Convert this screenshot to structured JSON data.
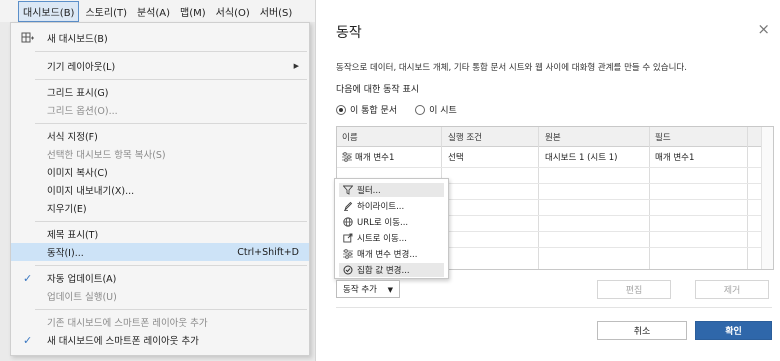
{
  "menubar": {
    "items": [
      "대시보드(B)",
      "스토리(T)",
      "분석(A)",
      "맵(M)",
      "서식(O)",
      "서버(S)"
    ],
    "active": "대시보드(B)"
  },
  "dropdown": {
    "items": [
      {
        "label": "새 대시보드(B)",
        "icon": "new-dashboard-icon"
      },
      {
        "label": "기기 레이아웃(L)",
        "submenu": true
      },
      {
        "label": "그리드 표시(G)"
      },
      {
        "label": "그리드 옵션(O)...",
        "disabled": true
      },
      {
        "label": "서식 지정(F)"
      },
      {
        "label": "선택한 대시보드 항목 복사(S)",
        "disabled": true
      },
      {
        "label": "이미지 복사(C)"
      },
      {
        "label": "이미지 내보내기(X)..."
      },
      {
        "label": "지우기(E)"
      },
      {
        "label": "제목 표시(T)"
      },
      {
        "label": "동작(I)...",
        "shortcut": "Ctrl+Shift+D",
        "highlighted": true
      },
      {
        "label": "자동 업데이트(A)",
        "checked": true
      },
      {
        "label": "업데이트 실행(U)",
        "disabled": true
      },
      {
        "label": "기존 대시보드에 스마트폰 레이아웃 추가",
        "disabled": true
      },
      {
        "label": "새 대시보드에 스마트폰 레이아웃 추가",
        "checked": true
      }
    ]
  },
  "dialog": {
    "title": "동작",
    "close_icon": "×",
    "description": "동작으로 데이터, 대시보드 개체, 기타 통합 문서 시트와 웹 사이에 대화형 관계를 만들 수 있습니다.",
    "for_label": "다음에 대한 동작 표시",
    "radio_options": [
      {
        "label": "이 통합 문서",
        "selected": true
      },
      {
        "label": "이 시트",
        "selected": false
      }
    ],
    "table": {
      "columns": [
        "이름",
        "실행 조건",
        "원본",
        "필드"
      ],
      "rows": [
        [
          "매개 변수1",
          "선택",
          "대시보드 1 (시트 1)",
          "매개 변수1"
        ]
      ]
    },
    "popup_menu": [
      {
        "label": "필터...",
        "icon": "filter-icon",
        "highlighted": true
      },
      {
        "label": "하이라이트...",
        "icon": "highlight-icon"
      },
      {
        "label": "URL로 이동...",
        "icon": "globe-icon"
      },
      {
        "label": "시트로 이동...",
        "icon": "go-to-sheet-icon"
      },
      {
        "label": "매개 변수 변경...",
        "icon": "parameter-icon"
      },
      {
        "label": "집합 값 변경...",
        "icon": "set-icon",
        "highlighted": true
      }
    ],
    "add_button": "동작 추가",
    "edit_button": "편집",
    "remove_button": "제거",
    "cancel_button": "취소",
    "ok_button": "확인"
  },
  "colors": {
    "accent": "#2f67aa",
    "menu_highlight": "#cde3f7",
    "check": "#3a78c2"
  }
}
